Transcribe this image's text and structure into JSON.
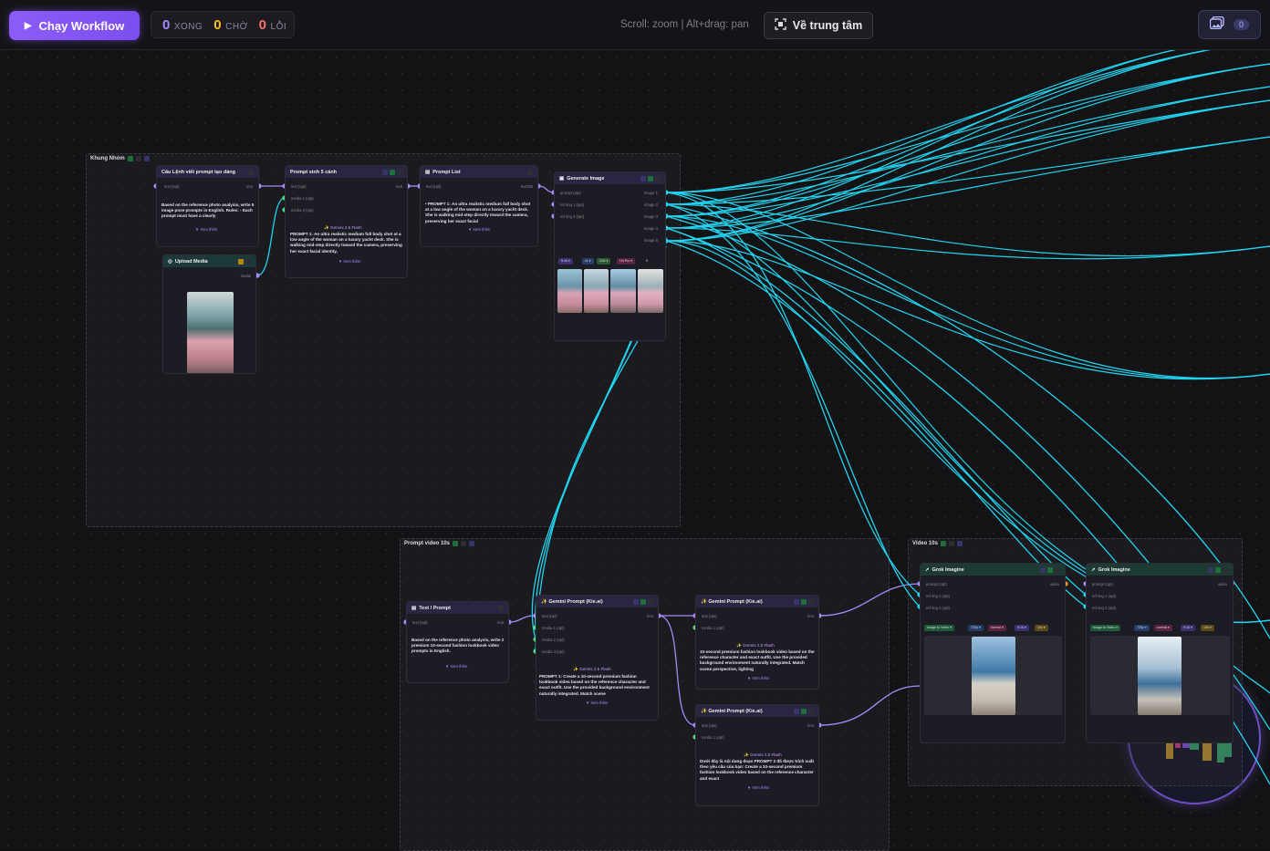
{
  "toolbar": {
    "run_label": "Chạy Workflow",
    "status": {
      "done_count": "0",
      "done_label": "XONG",
      "wait_count": "0",
      "wait_label": "CHỜ",
      "error_count": "0",
      "error_label": "LỖI"
    },
    "hint": "Scroll: zoom | Alt+drag: pan",
    "center_label": "Về trung tâm",
    "gallery_count": "0"
  },
  "colors": {
    "accent": "#8b5cf6",
    "done": "#a78bfa",
    "wait": "#fbbf24",
    "error": "#f87171",
    "wire_cyan": "#22d3ee",
    "wire_purple": "#a78bfa"
  },
  "groups": {
    "group1": {
      "title": "Khung Nhóm"
    },
    "group2": {
      "title": "Prompt video 10s"
    },
    "group3": {
      "title": "Video 10s"
    }
  },
  "nodes": {
    "cau_lenh": {
      "title": "Câu Lệnh viết prompt tạo dáng",
      "in_port": "text (opt)",
      "out_port": "text",
      "text": "Based on the reference photo analysis, write 5 image pose prompts in English. Rules: - Each prompt must have a clearly",
      "more": "▼ Xem thêm"
    },
    "upload": {
      "title": "Upload Media",
      "out_port": "media"
    },
    "prompt5": {
      "title": "Prompt sinh 5 cảnh",
      "ports": [
        "text (opt)",
        "media 1 (opt)",
        "media 2 (opt)"
      ],
      "out_port": "text",
      "model": "✨ Gemini 2.5 Flash",
      "text": "PROMPT 1: An ultra realistic medium full body shot at a low angle of the woman on a luxury yacht deck. She is walking mid-step directly toward the camera, preserving her exact facial identity,",
      "more": "▼ Xem thêm"
    },
    "prompt_list": {
      "title": "Prompt List",
      "in_port": "text (opt)",
      "out_port": "text/list",
      "text": "• PROMPT 1: An ultra realistic medium full body shot at a low angle of the woman on a luxury yacht deck. She is walking mid-step directly toward the camera, preserving her exact facial",
      "more": "▼ Xem thêm"
    },
    "gen_image": {
      "title": "Generate Image",
      "ports": [
        "prompt (opt)",
        "ref img 1 (opt)",
        "ref img 2 (opt)"
      ],
      "outs": [
        "image 1",
        "image 2",
        "image 3",
        "image 4",
        "image 5"
      ],
      "chips": [
        "9:16 ▾",
        "x1 ▾",
        "Gốc ▾",
        "Hd-Pro ▾",
        "5"
      ]
    },
    "text_prompt": {
      "title": "Text / Prompt",
      "in_port": "text (opt)",
      "out_port": "text",
      "text": "Based on the reference photo analysis, write 2 premium 10-second fashion lookbook video prompts in English.",
      "more": "▼ Xem thêm"
    },
    "gemini1": {
      "title": "✨ Gemini Prompt (Kie.ai)",
      "ports": [
        "text (opt)",
        "media 1 (opt)",
        "media 2 (opt)",
        "media 3 (opt)"
      ],
      "out_port": "text",
      "model": "✨ Gemini 2.5 Flash",
      "text": "PROMPT 1: Create a 10-second premium fashion lookbook video based on the reference character and exact outfit. Use the provided background environment naturally integrated. Match scene",
      "more": "▼ Xem thêm"
    },
    "gemini2": {
      "title": "✨ Gemini Prompt (Kie.ai)",
      "ports": [
        "text (opt)",
        "media 1 (opt)"
      ],
      "out_port": "text",
      "model": "✨ Gemini 2.5 Flash",
      "text": "10-second premium fashion lookbook video based on the reference character and exact outfit. Use the provided background environment naturally integrated. Match scene perspective, lighting",
      "more": "▼ Xem thêm"
    },
    "gemini3": {
      "title": "✨ Gemini Prompt (Kie.ai)",
      "ports": [
        "text (opt)",
        "media 1 (opt)"
      ],
      "out_port": "text",
      "model": "✨ Gemini 2.5 Flash",
      "text": "Dưới đây là nội dung đoạn PROMPT 2 đã được trích xuất theo yêu cầu của bạn: Create a 10-second premium fashion lookbook video based on the reference character and exact",
      "more": "▼ Xem thêm"
    },
    "grok1": {
      "title": "Grok Imagine",
      "ports": [
        "prompt (opt)",
        "ref img 1 (opt)",
        "ref img 2 (opt)"
      ],
      "out_port": "video",
      "chips": [
        "Image to Video ▾",
        "720p ▾",
        "normal ▾",
        "9:16 ▾",
        "10s ▾"
      ]
    },
    "grok2": {
      "title": "Grok Imagine",
      "ports": [
        "prompt (opt)",
        "ref img 1 (opt)",
        "ref img 2 (opt)"
      ],
      "out_port": "video",
      "chips": [
        "Image to Video ▾",
        "720p ▾",
        "normal ▾",
        "9:16 ▾",
        "10s ▾"
      ]
    }
  }
}
